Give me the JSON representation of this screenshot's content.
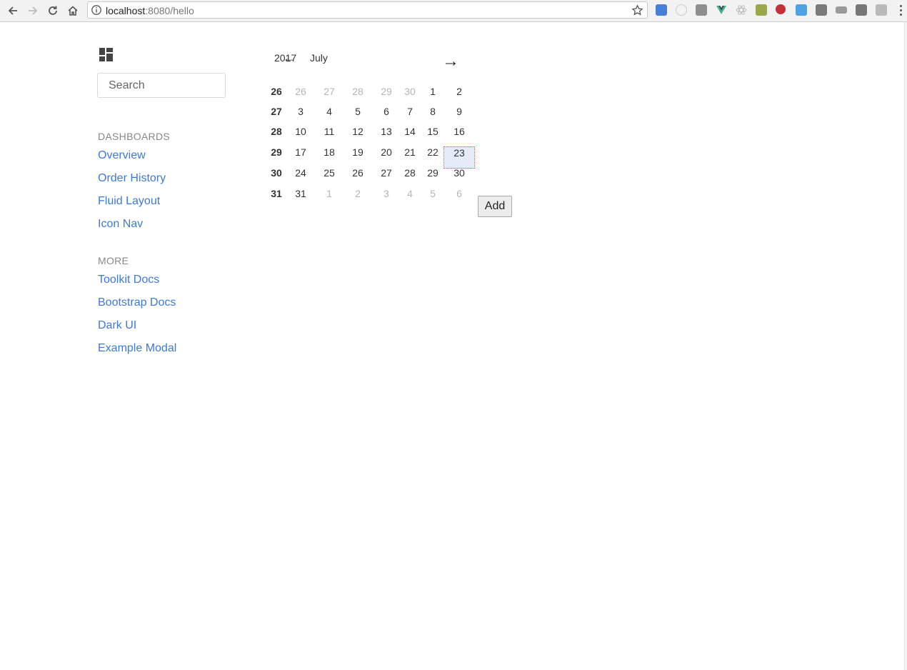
{
  "browser": {
    "url_host": "localhost",
    "url_rest": ":8080/hello"
  },
  "sidebar": {
    "search_placeholder": "Search",
    "section_dashboards": "DASHBOARDS",
    "dashboards": [
      "Overview",
      "Order History",
      "Fluid Layout",
      "Icon Nav"
    ],
    "section_more": "MORE",
    "more": [
      "Toolkit Docs",
      "Bootstrap Docs",
      "Dark UI",
      "Example Modal"
    ],
    "link_color": "#3c7ad9"
  },
  "calendar": {
    "year": "2017",
    "month": "July",
    "prev_arrow": "←",
    "next_arrow": "→",
    "selected_day": "23",
    "weeks": [
      {
        "week": "26",
        "days": [
          {
            "d": "26",
            "out": true
          },
          {
            "d": "27",
            "out": true
          },
          {
            "d": "28",
            "out": true
          },
          {
            "d": "29",
            "out": true
          },
          {
            "d": "30",
            "out": true
          },
          {
            "d": "1",
            "out": false
          },
          {
            "d": "2",
            "out": false
          }
        ]
      },
      {
        "week": "27",
        "days": [
          {
            "d": "3",
            "out": false
          },
          {
            "d": "4",
            "out": false
          },
          {
            "d": "5",
            "out": false
          },
          {
            "d": "6",
            "out": false
          },
          {
            "d": "7",
            "out": false
          },
          {
            "d": "8",
            "out": false
          },
          {
            "d": "9",
            "out": false
          }
        ]
      },
      {
        "week": "28",
        "days": [
          {
            "d": "10",
            "out": false
          },
          {
            "d": "11",
            "out": false
          },
          {
            "d": "12",
            "out": false
          },
          {
            "d": "13",
            "out": false
          },
          {
            "d": "14",
            "out": false
          },
          {
            "d": "15",
            "out": false
          },
          {
            "d": "16",
            "out": false
          }
        ]
      },
      {
        "week": "29",
        "days": [
          {
            "d": "17",
            "out": false
          },
          {
            "d": "18",
            "out": false
          },
          {
            "d": "19",
            "out": false
          },
          {
            "d": "20",
            "out": false
          },
          {
            "d": "21",
            "out": false
          },
          {
            "d": "22",
            "out": false
          },
          {
            "d": "23",
            "out": false,
            "selected": true
          }
        ]
      },
      {
        "week": "30",
        "days": [
          {
            "d": "24",
            "out": false
          },
          {
            "d": "25",
            "out": false
          },
          {
            "d": "26",
            "out": false
          },
          {
            "d": "27",
            "out": false
          },
          {
            "d": "28",
            "out": false
          },
          {
            "d": "29",
            "out": false
          },
          {
            "d": "30",
            "out": false
          }
        ]
      },
      {
        "week": "31",
        "days": [
          {
            "d": "31",
            "out": false
          },
          {
            "d": "1",
            "out": true
          },
          {
            "d": "2",
            "out": true
          },
          {
            "d": "3",
            "out": true
          },
          {
            "d": "4",
            "out": true
          },
          {
            "d": "5",
            "out": true
          },
          {
            "d": "6",
            "out": true
          }
        ]
      }
    ],
    "selected_bg": "#e3ecf8"
  },
  "add_button_label": "Add"
}
